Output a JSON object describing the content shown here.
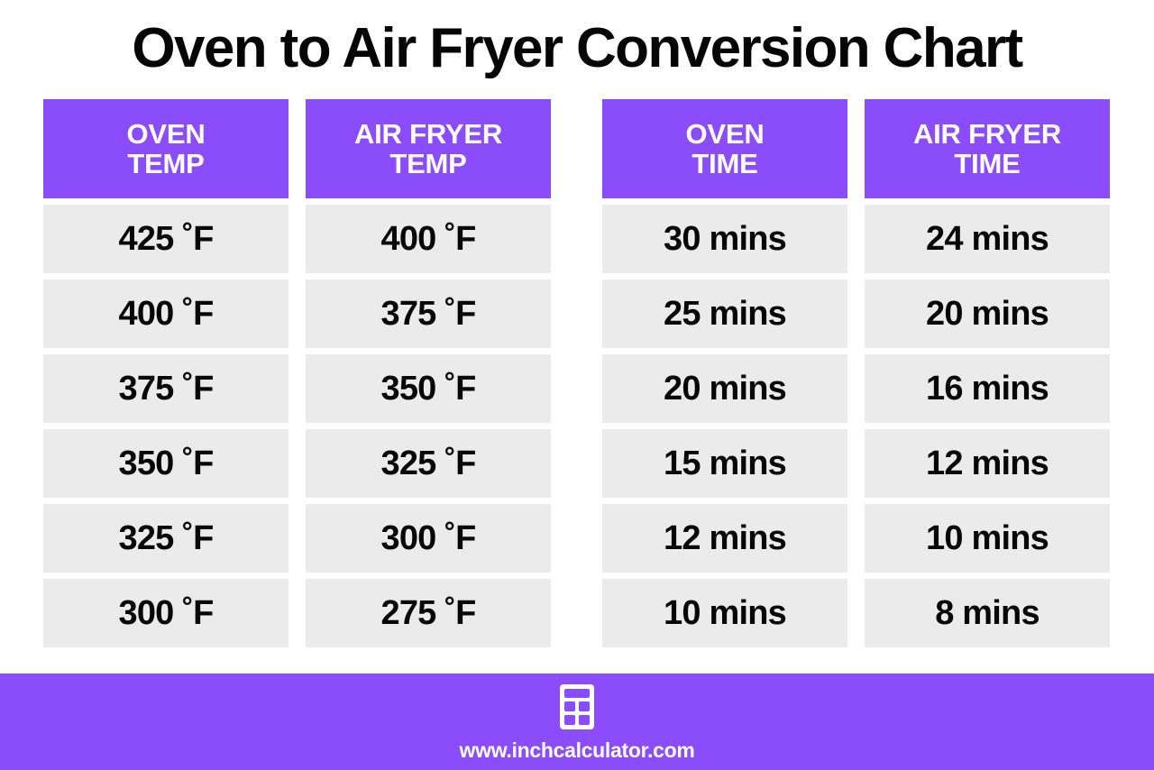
{
  "title": "Oven to Air Fryer Conversion Chart",
  "colors": {
    "accent_purple": "#8B4DFC",
    "cell_gray": "#EBEBEB",
    "text_black": "#070707",
    "header_text": "#FFFFFF",
    "background": "#FFFFFF"
  },
  "columns": [
    {
      "line1": "OVEN",
      "line2": "TEMP"
    },
    {
      "line1": "AIR FRYER",
      "line2": "TEMP"
    },
    {
      "line1": "OVEN",
      "line2": "TIME"
    },
    {
      "line1": "AIR FRYER",
      "line2": "TIME"
    }
  ],
  "rows": [
    {
      "oven_temp": "425 ˚F",
      "air_fryer_temp": "400 ˚F",
      "oven_time": "30 mins",
      "air_fryer_time": "24 mins"
    },
    {
      "oven_temp": "400 ˚F",
      "air_fryer_temp": "375 ˚F",
      "oven_time": "25 mins",
      "air_fryer_time": "20 mins"
    },
    {
      "oven_temp": "375 ˚F",
      "air_fryer_temp": "350 ˚F",
      "oven_time": "20 mins",
      "air_fryer_time": "16 mins"
    },
    {
      "oven_temp": "350 ˚F",
      "air_fryer_temp": "325 ˚F",
      "oven_time": "15 mins",
      "air_fryer_time": "12 mins"
    },
    {
      "oven_temp": "325 ˚F",
      "air_fryer_temp": "300 ˚F",
      "oven_time": "12 mins",
      "air_fryer_time": "10 mins"
    },
    {
      "oven_temp": "300 ˚F",
      "air_fryer_temp": "275 ˚F",
      "oven_time": "10 mins",
      "air_fryer_time": "8 mins"
    }
  ],
  "footer": {
    "icon": "calculator-icon",
    "url": "www.inchcalculator.com"
  },
  "chart_data": {
    "type": "table",
    "title": "Oven to Air Fryer Conversion Chart",
    "columns": [
      "OVEN TEMP",
      "AIR FRYER TEMP",
      "OVEN TIME",
      "AIR FRYER TIME"
    ],
    "rows": [
      [
        "425 ˚F",
        "400 ˚F",
        "30 mins",
        "24 mins"
      ],
      [
        "400 ˚F",
        "375 ˚F",
        "25 mins",
        "20 mins"
      ],
      [
        "375 ˚F",
        "350 ˚F",
        "20 mins",
        "16 mins"
      ],
      [
        "350 ˚F",
        "325 ˚F",
        "15 mins",
        "12 mins"
      ],
      [
        "325 ˚F",
        "300 ˚F",
        "12 mins",
        "10 mins"
      ],
      [
        "300 ˚F",
        "275 ˚F",
        "10 mins",
        "8 mins"
      ]
    ]
  }
}
